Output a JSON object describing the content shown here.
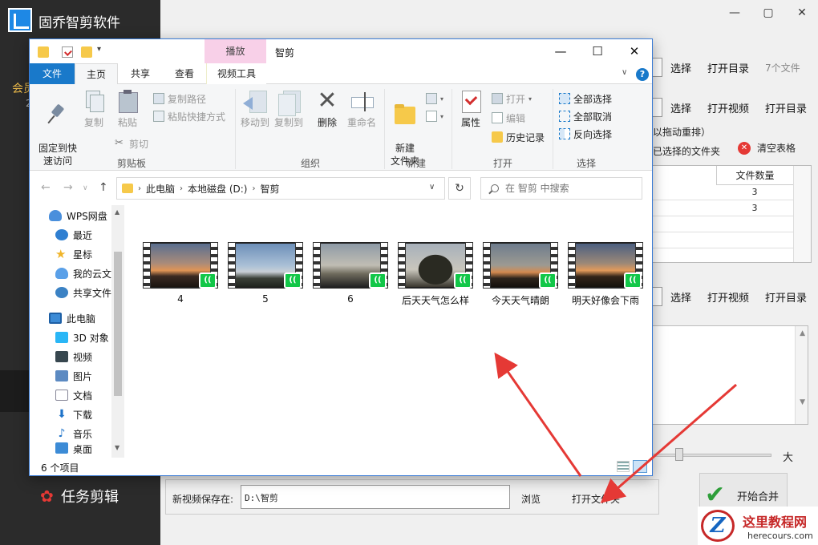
{
  "app": {
    "title": "固乔智剪软件",
    "member_label": "会员",
    "member_sub": "2",
    "task_edit_label": "任务剪辑",
    "right_panel": {
      "row1": {
        "select": "选择",
        "open_dir": "打开目录",
        "count": "7个文件"
      },
      "row2": {
        "select": "选择",
        "open_video": "打开视频",
        "open_dir": "打开目录"
      },
      "drag_hint": "以拖动重排）",
      "selected_folders": "已选择的文件夹",
      "clear_table": "清空表格",
      "table": {
        "header": "文件数量",
        "rows": [
          "3",
          "3"
        ]
      },
      "row3": {
        "select": "选择",
        "open_video": "打开视频",
        "open_dir": "打开目录"
      },
      "size_big": "大"
    },
    "save": {
      "label": "新视频保存在:",
      "path": "D:\\智剪",
      "browse": "浏览",
      "open_folder": "打开文件夹"
    },
    "start_merge": "开始合并",
    "watermark": {
      "brand": "这里教程网",
      "url": "herecours.com"
    }
  },
  "explorer": {
    "window_title": "智剪",
    "contextual_tab": "播放",
    "tabs": [
      "文件",
      "主页",
      "共享",
      "查看",
      "视频工具"
    ],
    "ribbon": {
      "clipboard": {
        "title": "剪贴板",
        "pin": "固定到快\n速访问",
        "copy": "复制",
        "paste": "粘贴",
        "copy_path": "复制路径",
        "paste_shortcut": "粘贴快捷方式",
        "cut": "剪切"
      },
      "organize": {
        "title": "组织",
        "move_to": "移动到",
        "copy_to": "复制到",
        "delete": "删除",
        "rename": "重命名"
      },
      "new": {
        "title": "新建",
        "new_folder": "新建\n文件夹"
      },
      "open": {
        "title": "打开",
        "properties": "属性",
        "open": "打开",
        "edit": "编辑",
        "history": "历史记录"
      },
      "select": {
        "title": "选择",
        "select_all": "全部选择",
        "select_none": "全部取消",
        "invert": "反向选择"
      }
    },
    "address": [
      "此电脑",
      "本地磁盘 (D:)",
      "智剪"
    ],
    "search_placeholder": "在 智剪 中搜索",
    "nav": [
      {
        "label": "WPS网盘",
        "icon": "cloud-icon"
      },
      {
        "label": "最近",
        "icon": "clock-icon"
      },
      {
        "label": "星标",
        "icon": "star-icon"
      },
      {
        "label": "我的云文",
        "icon": "cloud-doc-icon"
      },
      {
        "label": "共享文件",
        "icon": "share-icon"
      },
      {
        "label": "此电脑",
        "icon": "computer-icon"
      },
      {
        "label": "3D 对象",
        "icon": "cube-icon"
      },
      {
        "label": "视频",
        "icon": "video-icon"
      },
      {
        "label": "图片",
        "icon": "pictures-icon"
      },
      {
        "label": "文档",
        "icon": "documents-icon"
      },
      {
        "label": "下载",
        "icon": "download-icon"
      },
      {
        "label": "音乐",
        "icon": "music-icon"
      },
      {
        "label": "桌面",
        "icon": "desktop-icon"
      }
    ],
    "files": [
      {
        "name": "4",
        "thumb": "sunset"
      },
      {
        "name": "5",
        "thumb": "sky"
      },
      {
        "name": "6",
        "thumb": "dusk"
      },
      {
        "name": "后天天气怎么样",
        "thumb": "tree"
      },
      {
        "name": "今天天气晴朗",
        "thumb": "clear"
      },
      {
        "name": "明天好像会下雨",
        "thumb": "rain"
      }
    ],
    "status": "6 个项目"
  },
  "colors": {
    "accent": "#1979ca",
    "annotation": "#e53935",
    "badge": "#12c748",
    "contextual_tab": "#f8d0e8"
  }
}
